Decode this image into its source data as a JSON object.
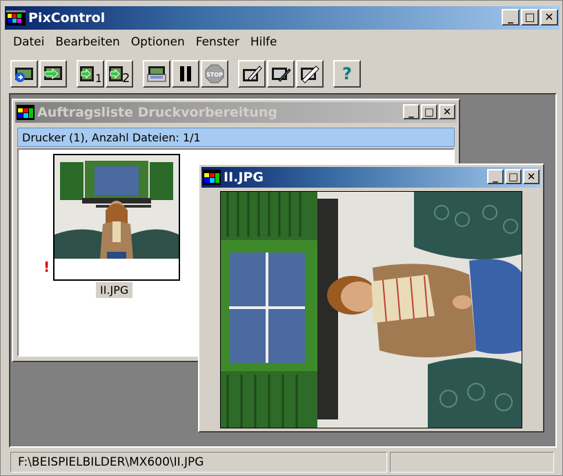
{
  "app": {
    "title": "PixControl",
    "buttons": {
      "minimize": "_",
      "maximize": "□",
      "close": "✕"
    }
  },
  "menu": [
    "Datei",
    "Bearbeiten",
    "Optionen",
    "Fenster",
    "Hilfe"
  ],
  "toolbar": {
    "button_2_label": "1",
    "button_3_label": "2",
    "help_label": "?",
    "stop_label": "STOP"
  },
  "job_window": {
    "title": "Auftragsliste Druckvorbereitung",
    "info": "Drucker (1), Anzahl Dateien: 1/1",
    "files": [
      {
        "name": "II.JPG",
        "warning": "!"
      }
    ]
  },
  "image_window": {
    "title": "II.JPG"
  },
  "status": {
    "path": "F:\\BEISPIELBILDER\\MX600\\II.JPG",
    "right": ""
  },
  "colors": {
    "active_title": "#0a246a",
    "inactive_title": "#808080",
    "info_bar": "#a6caf0",
    "warning": "#e00000"
  }
}
